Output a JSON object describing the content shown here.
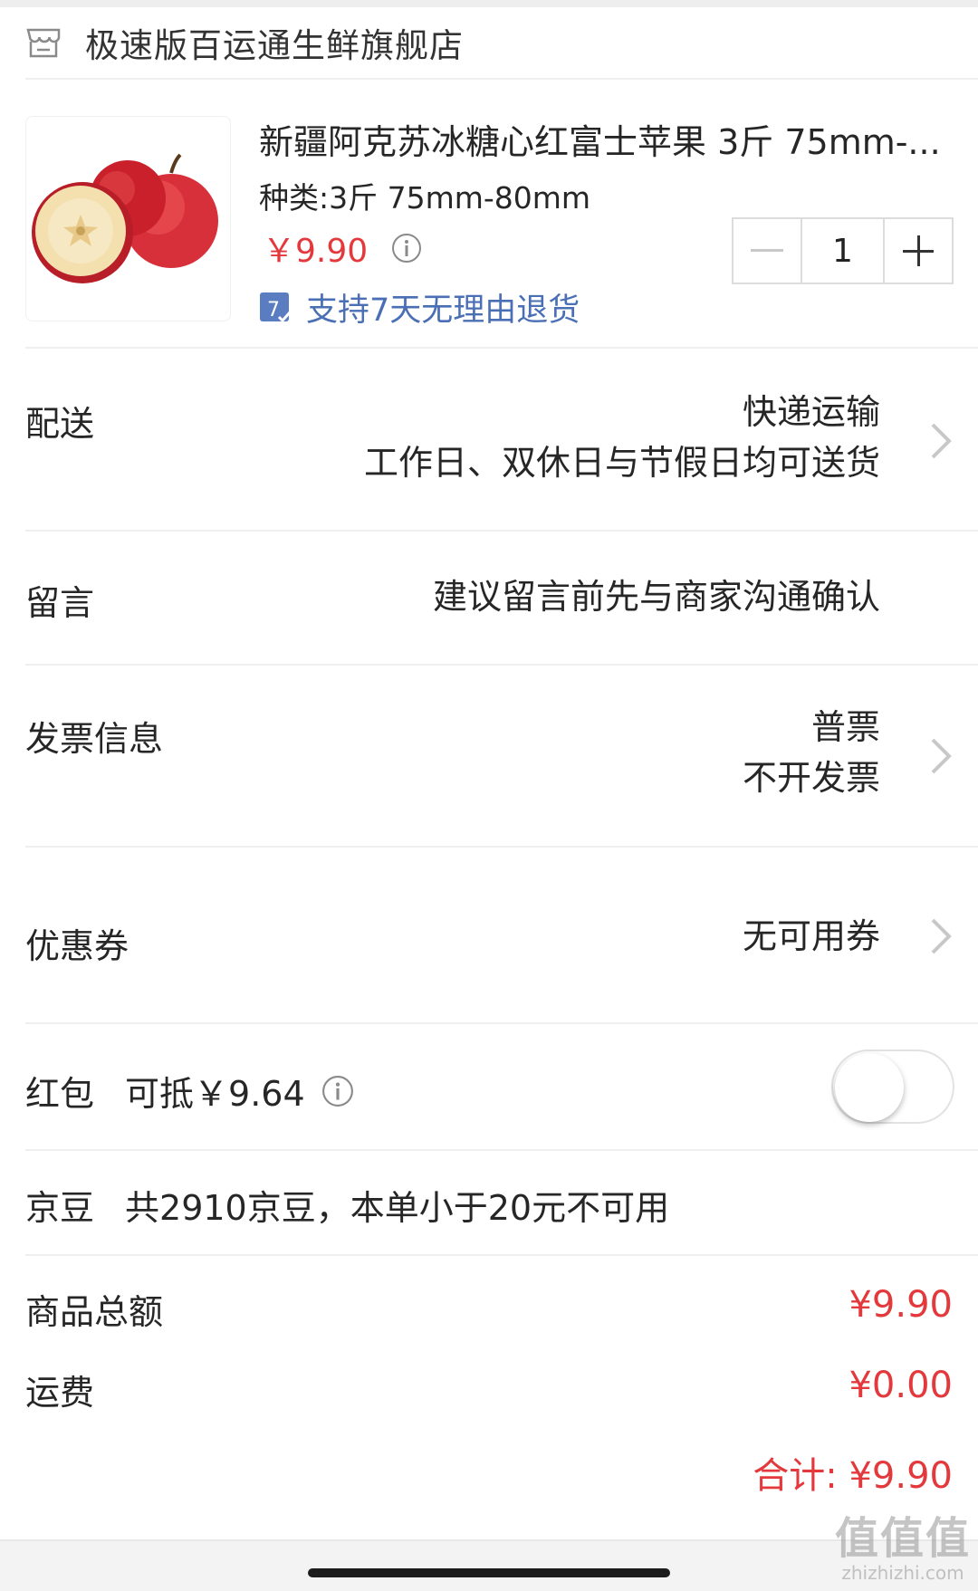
{
  "shop": {
    "name": "极速版百运通生鲜旗舰店",
    "icon": "store-icon"
  },
  "product": {
    "title": "新疆阿克苏冰糖心红富士苹果 3斤 75mm-...",
    "spec": "种类:3斤 75mm-80mm",
    "price": "￥9.90",
    "return_policy": "支持7天无理由退货",
    "return_badge": "7",
    "quantity": "1",
    "image_icon": "apple-product-image"
  },
  "delivery": {
    "label": "配送",
    "method": "快递运输",
    "schedule": "工作日、双休日与节假日均可送货"
  },
  "message": {
    "label": "留言",
    "placeholder": "建议留言前先与商家沟通确认"
  },
  "invoice": {
    "label": "发票信息",
    "type": "普票",
    "status": "不开发票"
  },
  "coupon": {
    "label": "优惠券",
    "value": "无可用券"
  },
  "red_packet": {
    "label": "红包",
    "deduct": "可抵￥9.64",
    "enabled": false
  },
  "jingdou": {
    "label": "京豆",
    "text": "共2910京豆，本单小于20元不可用"
  },
  "summary": {
    "goods_label": "商品总额",
    "goods_value": "¥9.90",
    "shipping_label": "运费",
    "shipping_value": "¥0.00",
    "total": "合计: ¥9.90"
  },
  "watermark": {
    "title": "值值值",
    "url": "zhizhizhi.com"
  },
  "colors": {
    "price_red": "#e4393c",
    "link_blue": "#4a6fb5",
    "divider": "#efefef"
  }
}
